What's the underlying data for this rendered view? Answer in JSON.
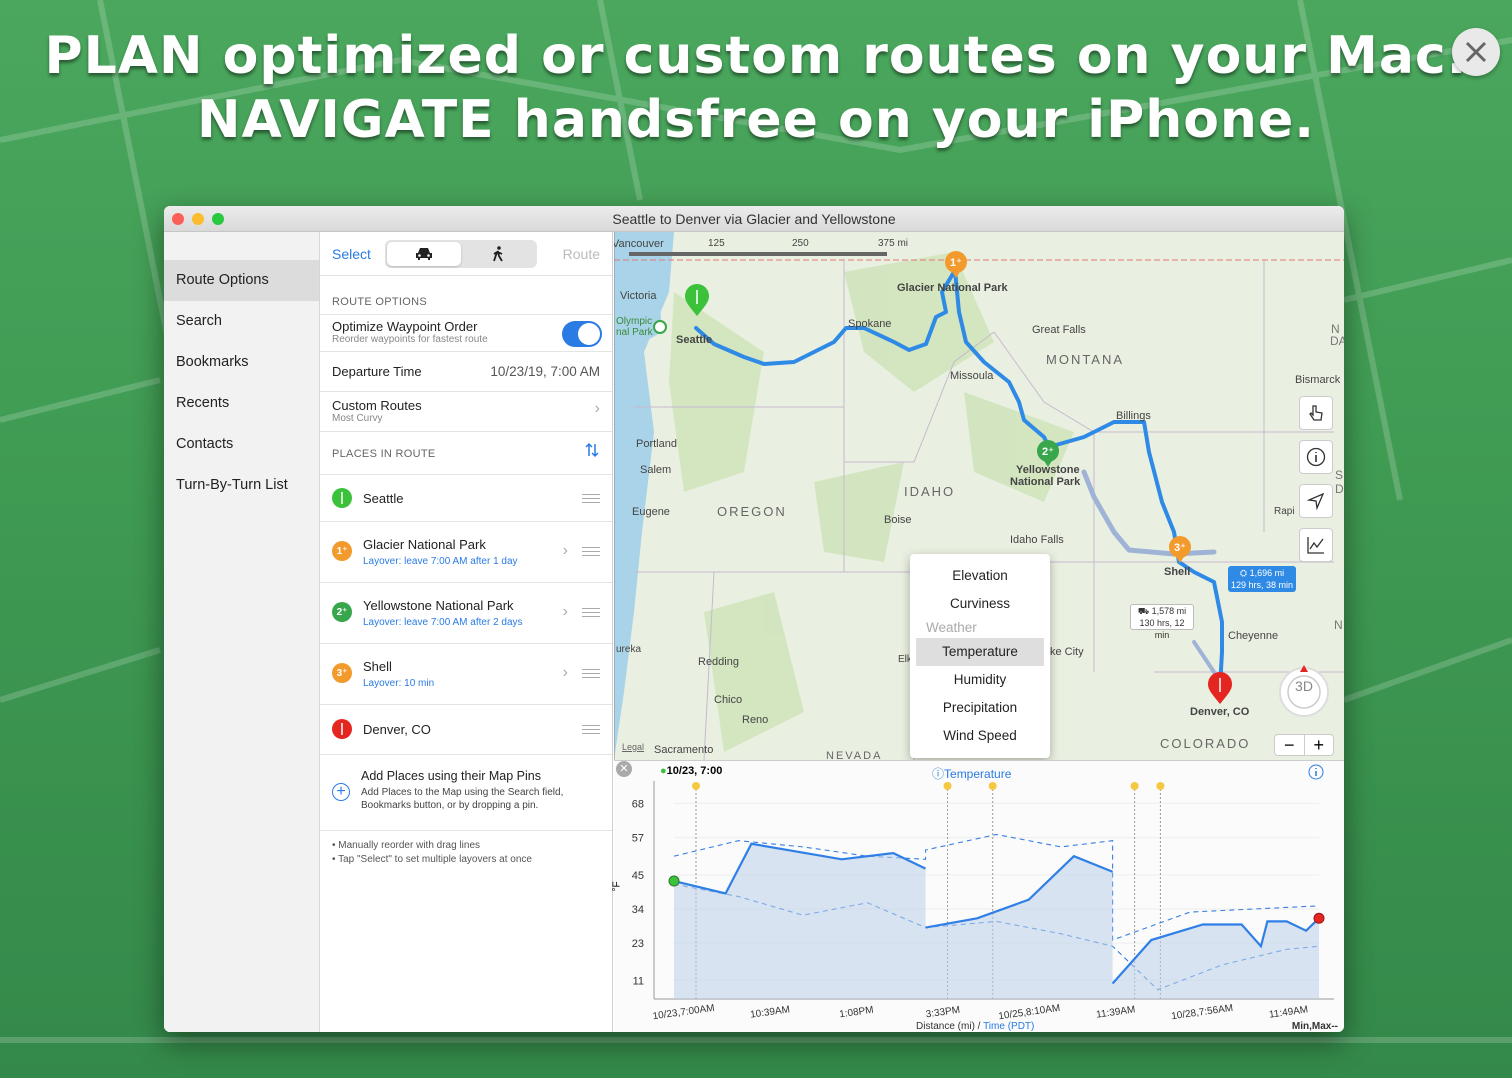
{
  "headline": {
    "line1": "PLAN optimized or custom routes on your Mac.",
    "line2": "NAVIGATE handsfree on your iPhone."
  },
  "window": {
    "title": "Seattle to Denver via Glacier and Yellowstone"
  },
  "sidebar": {
    "items": [
      "Route Options",
      "Search",
      "Bookmarks",
      "Recents",
      "Contacts",
      "Turn-By-Turn List"
    ],
    "selected": "Route Options"
  },
  "panel": {
    "select_label": "Select",
    "route_label": "Route",
    "route_options_header": "ROUTE OPTIONS",
    "optimize": {
      "title": "Optimize Waypoint Order",
      "sub": "Reorder waypoints for fastest route",
      "on": true
    },
    "departure": {
      "label": "Departure Time",
      "value": "10/23/19, 7:00 AM"
    },
    "custom": {
      "title": "Custom Routes",
      "sub": "Most Curvy"
    },
    "places_header": "PLACES IN ROUTE",
    "places": [
      {
        "num": "",
        "name": "Seattle",
        "layover": "",
        "color": "#3cc13b"
      },
      {
        "num": "1",
        "name": "Glacier National Park",
        "layover": "Layover: leave 7:00 AM after 1 day",
        "color": "#f39a2d"
      },
      {
        "num": "2",
        "name": "Yellowstone National Park",
        "layover": "Layover: leave 7:00 AM after 2 days",
        "color": "#38a64a"
      },
      {
        "num": "3",
        "name": "Shell",
        "layover": "Layover: 10 min",
        "color": "#f39a2d"
      },
      {
        "num": "",
        "name": "Denver, CO",
        "layover": "",
        "color": "#e5251f"
      }
    ],
    "add": {
      "title": "Add Places using their Map Pins",
      "sub1": "Add Places to the Map using the Search field,",
      "sub2": "Bookmarks button, or by dropping a pin."
    },
    "notes": [
      "• Manually reorder with drag lines",
      "• Tap \"Select\" to set multiple layovers at once"
    ]
  },
  "map": {
    "scale": [
      "0",
      "125",
      "250",
      "375 mi"
    ],
    "labels": {
      "vancouver": "Vancouver",
      "victoria": "Victoria",
      "olympic": "Olympic",
      "natpark": "nal Park",
      "seattle": "Seattle",
      "spokane": "Spokane",
      "glacier": "Glacier National Park",
      "greatfalls": "Great Falls",
      "missoula": "Missoula",
      "billings": "Billings",
      "bismarck": "Bismarck",
      "portland": "Portland",
      "salem": "Salem",
      "eugene": "Eugene",
      "boise": "Boise",
      "idahofalls": "Idaho Falls",
      "yellowstone1": "Yellowstone",
      "yellowstone2": "National Park",
      "shell": "Shell",
      "cheyenne": "Cheyenne",
      "denver": "Denver, CO",
      "redding": "Redding",
      "chico": "Chico",
      "reno": "Reno",
      "sacramento": "Sacramento",
      "eureka": "ureka",
      "saltlake": "ke City",
      "elk": "Elk",
      "rapid": "Rapi",
      "legal": "Legal",
      "nd": "N",
      "da": "DA",
      "sd": "S",
      "d2": "D",
      "n2": "N"
    },
    "states": {
      "montana": "MONTANA",
      "idaho": "IDAHO",
      "oregon": "OREGON",
      "colorado": "COLORADO",
      "nevada": "NEVADA"
    },
    "callout1": {
      "line1": "⛭ 1,696 mi",
      "line2": "129 hrs, 38 min"
    },
    "callout2": {
      "line1": "⛟ 1,578 mi",
      "line2": "130 hrs, 12 min"
    },
    "compass": "3D"
  },
  "chart_menu": {
    "items": [
      "Elevation",
      "Curviness",
      "Weather",
      "Temperature",
      "Humidity",
      "Precipitation",
      "Wind Speed"
    ],
    "selected": "Temperature",
    "section": "Weather"
  },
  "chart_data": {
    "type": "line",
    "title": "Temperature",
    "start_label": "10/23, 7:00",
    "ylabel": "°F",
    "xlabel": "Distance (mi) / Time (PDT)",
    "minmax_label": "Min,Max",
    "y_ticks": [
      68,
      57,
      45,
      34,
      23,
      11
    ],
    "ylim": [
      5,
      72
    ],
    "x_ticks": [
      "10/23,7:00AM",
      "10:39AM",
      "1:08PM",
      "3:33PM",
      "10/25,8:10AM",
      "11:39AM",
      "10/28,7:56AM",
      "11:49AM"
    ],
    "x": [
      0.0,
      0.1,
      0.15,
      0.3,
      0.4,
      0.5,
      0.6,
      0.7,
      0.8,
      0.9,
      1.0
    ],
    "series": [
      {
        "segment": 1,
        "values": [
          [
            0.0,
            43
          ],
          [
            0.08,
            39
          ],
          [
            0.12,
            55
          ],
          [
            0.26,
            50
          ],
          [
            0.34,
            52
          ],
          [
            0.39,
            47
          ]
        ]
      },
      {
        "segment": 2,
        "values": [
          [
            0.39,
            28
          ],
          [
            0.47,
            31
          ],
          [
            0.55,
            37
          ],
          [
            0.62,
            51
          ],
          [
            0.68,
            46
          ]
        ]
      },
      {
        "segment": 3,
        "values": [
          [
            0.68,
            10
          ],
          [
            0.74,
            24
          ],
          [
            0.82,
            29
          ],
          [
            0.88,
            29
          ],
          [
            0.91,
            22
          ],
          [
            0.92,
            30
          ],
          [
            0.95,
            30
          ],
          [
            0.98,
            27
          ],
          [
            1.0,
            31
          ]
        ]
      }
    ],
    "max_band": [
      [
        0.0,
        51
      ],
      [
        0.1,
        56
      ],
      [
        0.2,
        54
      ],
      [
        0.3,
        51
      ],
      [
        0.39,
        50
      ],
      [
        0.39,
        53
      ],
      [
        0.5,
        58
      ],
      [
        0.6,
        54
      ],
      [
        0.68,
        56
      ],
      [
        0.68,
        24
      ],
      [
        0.8,
        33
      ],
      [
        0.9,
        34
      ],
      [
        1.0,
        35
      ]
    ],
    "min_band": [
      [
        0.0,
        42
      ],
      [
        0.1,
        38
      ],
      [
        0.2,
        32
      ],
      [
        0.3,
        36
      ],
      [
        0.39,
        28
      ],
      [
        0.5,
        30
      ],
      [
        0.6,
        26
      ],
      [
        0.68,
        22
      ],
      [
        0.75,
        8
      ],
      [
        0.85,
        16
      ],
      [
        0.95,
        21
      ],
      [
        1.0,
        22
      ]
    ]
  },
  "colors": {
    "accent": "#2a7be4",
    "route": "#2f8ae6",
    "alt_route": "#9bb2d6",
    "bg_green": "#45a357"
  }
}
